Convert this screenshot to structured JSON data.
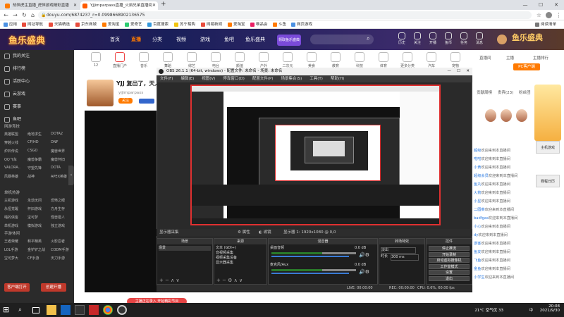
{
  "browser": {
    "tabs": [
      {
        "label": "热恒虎生直播_虎恒游戏精彩直播",
        "color": "#ff7a00"
      },
      {
        "label": "YJJimparpaxs直播_火焰兄弟直播间",
        "color": "#ff5a00"
      }
    ],
    "new_tab": "+",
    "url": "douyu.com/6874237_r=0.0998668902136575",
    "bookmarks": [
      {
        "label": "应用",
        "color": "#4a90e2"
      },
      {
        "label": "网址导航",
        "color": "#e74c3c"
      },
      {
        "label": "天猫精选",
        "color": "#e74c3c"
      },
      {
        "label": "京东商城",
        "color": "#e74c3c"
      },
      {
        "label": "爱淘宝",
        "color": "#ff7a00"
      },
      {
        "label": "爱奇艺",
        "color": "#2ecc71"
      },
      {
        "label": "百度搜索",
        "color": "#3498db"
      },
      {
        "label": "苏宁易购",
        "color": "#f1c40f"
      },
      {
        "label": "网易新闻",
        "color": "#e74c3c"
      },
      {
        "label": "爱淘宝",
        "color": "#ff7a00"
      },
      {
        "label": "唯品会",
        "color": "#e91e63"
      },
      {
        "label": "斗鱼",
        "color": "#ff7a00"
      },
      {
        "label": "网页游戏",
        "color": "#4a90e2"
      }
    ],
    "reading_list": "阅读清单"
  },
  "douyu": {
    "nav": [
      "首页",
      "直播",
      "分类",
      "视频",
      "游戏",
      "鱼吧",
      "鱼乐盛典"
    ],
    "logo_text": "鱼乐盛典",
    "promo": "领取鱼乐盛典",
    "user_items": [
      "历史",
      "关注",
      "开播",
      "鱼币",
      "任务",
      "消息"
    ]
  },
  "sidebar": {
    "top": [
      "我的关注",
      "排行榜",
      "活跃中心",
      "云游戏",
      "赛事",
      "鱼吧"
    ],
    "section1": "网游竞技",
    "grid1": [
      "英雄联盟",
      "绝地求生",
      "DOTA2",
      "穿越火线",
      "CF/HD",
      "DNF",
      "炉石传说",
      "CSGO",
      "魔兽世界",
      "QQ飞车",
      "魔兽争霸",
      "魔兽怀旧",
      "VALORA..",
      "守望先锋",
      "DOTA",
      "风暴英雄",
      "战神",
      "APEX英雄"
    ],
    "section2": "单机热游",
    "grid2": [
      "主机游戏",
      "永劫无间",
      "恐怖之眼",
      "永恒觉醒",
      "怀旧游戏",
      "方舟生存",
      "喵的侠客",
      "宝可梦",
      "怪兽猎人",
      "单机游戏",
      "模拟游戏",
      "独立游戏"
    ],
    "section3": "手游休闲",
    "grid3": [
      "王者荣耀",
      "和平精英",
      "火影忍者",
      "LOL手游",
      "金铲铲之战",
      "CODM手游",
      "宝可梦大",
      "CF手游",
      "天刀手游"
    ],
    "btn_left": "客户端打开",
    "btn_right": "创建开播"
  },
  "categories": [
    "12",
    "直播门户",
    "音乐",
    "舞蹈",
    "综艺",
    "电台",
    "颜值",
    "户外",
    "二次元",
    "美食",
    "教育",
    "科技",
    "体育",
    "更多分类",
    "汽车",
    "宠物"
  ],
  "room": {
    "title": "YJJ 复出了，天人",
    "streamer": "yjjimparpaxs",
    "follow": "关注"
  },
  "right_panel": {
    "links": [
      "直播间",
      "主播",
      "主播排行"
    ],
    "ad": "PC客户端",
    "rank": [
      "贡献周榜",
      "贵宾(23)",
      "粉丝团"
    ],
    "chats": [
      {
        "name": "超级",
        "msg": "欢迎来到本直播间"
      },
      {
        "name": "啦啦",
        "msg": "欢迎来到本直播间"
      },
      {
        "name": "小黄",
        "msg": "欢迎来到本直播间"
      },
      {
        "name": "超级会员",
        "msg": "欢迎来到本直播间"
      },
      {
        "name": "鱼丸",
        "msg": "欢迎来到本直播间"
      },
      {
        "name": "火箭",
        "msg": "欢迎来到本直播间"
      },
      {
        "name": "小星",
        "msg": "欢迎来到本直播间"
      },
      {
        "name": "二圆菜",
        "msg": "欢迎来到本直播间"
      },
      {
        "name": "badfgas",
        "msg": "欢迎来到本直播间"
      },
      {
        "name": "小心",
        "msg": "欢迎来到本直播间"
      },
      {
        "name": "dy",
        "msg": "欢迎来到本直播间"
      },
      {
        "name": "游客",
        "msg": "欢迎来到本直播间"
      },
      {
        "name": "鱼友",
        "msg": "欢迎来到本直播间"
      },
      {
        "name": "飞鱼",
        "msg": "欢迎来到本直播间"
      },
      {
        "name": "金鱼",
        "msg": "欢迎来到本直播间"
      },
      {
        "name": "小学生",
        "msg": "欢迎来到本直播间"
      }
    ],
    "box_labels": [
      "主机游戏",
      "赛程日历"
    ]
  },
  "obs": {
    "title": "OBS 26.1.1 (64-bit, windows) - 配置文件: 未命名 - 场景: 未命名",
    "menu": [
      "文件(F)",
      "编辑(E)",
      "视图(V)",
      "停靠窗口(D)",
      "配置文件(P)",
      "场景集合(S)",
      "工具(T)",
      "帮助(H)"
    ],
    "toolbar_left": "显示器采集",
    "toolbar_props": "属性",
    "toolbar_filter": "滤镜",
    "toolbar_display": "显示器 1: 1920x1080 @ 0,0",
    "docks": {
      "scenes": {
        "title": "场景",
        "items": [
          "场景"
        ]
      },
      "sources": {
        "title": "来源",
        "items": [
          "文本 (GDI+)",
          "音视频采集",
          "视频采集设备",
          "显示器采集"
        ]
      },
      "mixer": {
        "title": "混音器",
        "ch1": "桌面音频",
        "db1": "0.0 dB",
        "ch2": "麦克风/Aux",
        "db2": "0.0 dB"
      },
      "transition": {
        "title": "转场特效",
        "type": "淡出",
        "duration_label": "时长",
        "duration": "300 ms"
      },
      "controls": {
        "title": "控件",
        "buttons": [
          "停止推流",
          "开始录制",
          "启动虚拟摄像机",
          "工作室模式",
          "设置",
          "退出"
        ]
      }
    },
    "status": {
      "live": "LIVE: 00:00:00",
      "rec": "REC: 00:00:00",
      "cpu": "CPU: 0.6%, 60.00 fps"
    }
  },
  "bottom_tag": "主播正在录入 开始精彩节目",
  "taskbar": {
    "weather": "21°C 空气优 33",
    "time": "20:08",
    "date": "2021/9/30",
    "lang": "中"
  }
}
